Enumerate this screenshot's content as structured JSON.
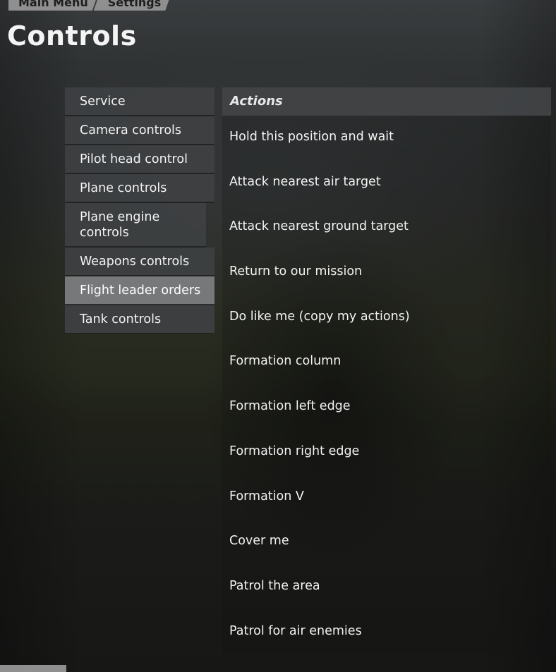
{
  "breadcrumb": {
    "items": [
      "Main Menu",
      "Settings"
    ]
  },
  "page_title": "Controls",
  "sidebar": {
    "items": [
      {
        "label": "Service",
        "active": false
      },
      {
        "label": "Camera controls",
        "active": false
      },
      {
        "label": "Pilot head control",
        "active": false
      },
      {
        "label": "Plane controls",
        "active": false
      },
      {
        "label": "Plane engine controls",
        "active": false
      },
      {
        "label": "Weapons controls",
        "active": false
      },
      {
        "label": "Flight leader orders",
        "active": true
      },
      {
        "label": "Tank controls",
        "active": false
      }
    ]
  },
  "main": {
    "section_header": "Actions",
    "actions": [
      "Hold this position and wait",
      "Attack nearest air target",
      "Attack nearest ground target",
      "Return to our mission",
      "Do like me (copy my actions)",
      "Formation column",
      "Formation left edge",
      "Formation right edge",
      "Formation V",
      "Cover me",
      "Patrol the area",
      "Patrol for air enemies"
    ]
  },
  "colors": {
    "breadcrumb_bg": "#8f8f8f",
    "sidebar_item_bg": "#3e4042",
    "sidebar_active_bg": "#7a7c7e",
    "header_bg": "#424446",
    "text": "#f3f3f3"
  }
}
